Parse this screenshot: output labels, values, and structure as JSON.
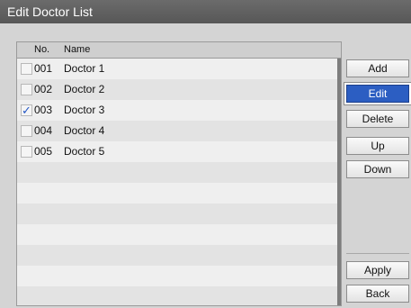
{
  "window": {
    "title": "Edit Doctor List"
  },
  "list": {
    "columns": {
      "no": "No.",
      "name": "Name"
    },
    "rows": [
      {
        "no": "001",
        "name": "Doctor 1",
        "checked": false,
        "check_mark": ""
      },
      {
        "no": "002",
        "name": "Doctor 2",
        "checked": false,
        "check_mark": ""
      },
      {
        "no": "003",
        "name": "Doctor 3",
        "checked": true,
        "check_mark": "✓"
      },
      {
        "no": "004",
        "name": "Doctor 4",
        "checked": false,
        "check_mark": ""
      },
      {
        "no": "005",
        "name": "Doctor 5",
        "checked": false,
        "check_mark": ""
      }
    ]
  },
  "buttons": {
    "add": "Add",
    "edit": "Edit",
    "delete": "Delete",
    "up": "Up",
    "down": "Down",
    "apply": "Apply",
    "back": "Back"
  },
  "colors": {
    "selected_button": "#2c5ec2",
    "check": "#2457c5",
    "title_bar": "#5f5f5f"
  }
}
